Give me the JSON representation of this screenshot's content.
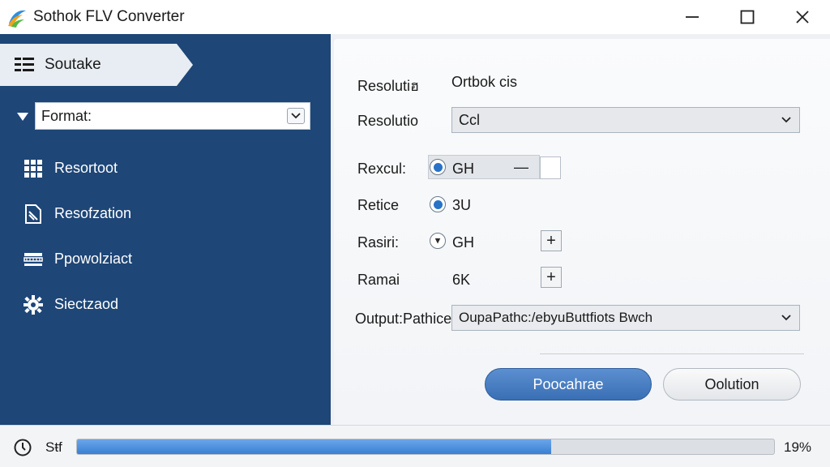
{
  "window": {
    "title": "Sothok FLV Converter",
    "icon": "app-logo-icon"
  },
  "sidebar": {
    "active_item": {
      "label": "Soutake",
      "icon": "list-icon"
    },
    "format": {
      "label": "Format:"
    },
    "items": [
      {
        "label": "Resortoot",
        "icon": "grid-icon"
      },
      {
        "label": "Resofzation",
        "icon": "document-icon"
      },
      {
        "label": "Ppowolziact",
        "icon": "ruler-icon"
      },
      {
        "label": "Siectzaod",
        "icon": "gear-icon"
      }
    ]
  },
  "main": {
    "row1": {
      "label": "Resolutiฮ",
      "value": "Ortbok cis"
    },
    "row2": {
      "label": "Resolutio",
      "value": "Ccl"
    },
    "row3": {
      "label": "Rexcul:",
      "option": "GH",
      "dash": "—"
    },
    "row4": {
      "label": "Retice",
      "option": "3U"
    },
    "row5": {
      "label": "Rasiri:",
      "option": "GH",
      "plus": "+"
    },
    "row6": {
      "label": "Ramai",
      "value": "6K",
      "plus": "+"
    },
    "output": {
      "label": "Output:Pathice",
      "value": "OupaPathc:/ebyuButtfiots Bwch"
    },
    "buttons": {
      "primary": "Poocahrae",
      "secondary": "Oolution"
    }
  },
  "status": {
    "label": "Sŧf",
    "value": "19%",
    "progress": 0.68
  },
  "colors": {
    "sidebar_bg": "#1e4677",
    "accent": "#3a7fd3",
    "primary_button": "#4a7fc3"
  }
}
